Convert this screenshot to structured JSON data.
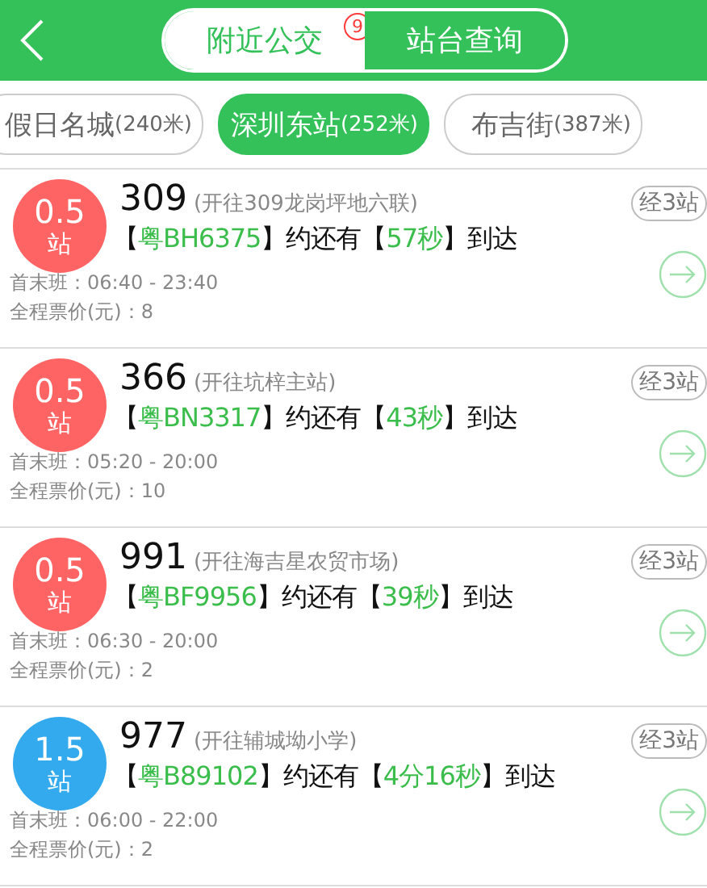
{
  "header": {
    "tabs": [
      {
        "label": "附近公交",
        "selected": true,
        "badge": "9"
      },
      {
        "label": "站台查询",
        "selected": false
      }
    ]
  },
  "stations": [
    {
      "label": "假日名城",
      "distance": "(240米)",
      "selected": false
    },
    {
      "label": "深圳东站",
      "distance": "(252米)",
      "selected": true
    },
    {
      "label": "布吉街",
      "distance": "(387米)",
      "selected": false
    }
  ],
  "buses": [
    {
      "stops": "0.5",
      "stops_unit": "站",
      "color": "#ff6464",
      "route": "309",
      "destination": "(开往309龙岗坪地六联)",
      "arrival": [
        {
          "text": "【",
          "highlight": false
        },
        {
          "text": "粤BH6375",
          "highlight": true
        },
        {
          "text": "】约还有【",
          "highlight": false
        },
        {
          "text": "57秒",
          "highlight": true
        },
        {
          "text": "】到达",
          "highlight": false
        }
      ],
      "hours": "首末班：06:40 - 23:40",
      "fare": "全程票价(元)：8",
      "via": "经3站"
    },
    {
      "stops": "0.5",
      "stops_unit": "站",
      "color": "#ff6464",
      "route": "366",
      "destination": "(开往坑梓主站)",
      "arrival": [
        {
          "text": "【",
          "highlight": false
        },
        {
          "text": "粤BN3317",
          "highlight": true
        },
        {
          "text": "】约还有【",
          "highlight": false
        },
        {
          "text": "43秒",
          "highlight": true
        },
        {
          "text": "】到达",
          "highlight": false
        }
      ],
      "hours": "首末班：05:20 - 20:00",
      "fare": "全程票价(元)：10",
      "via": "经3站"
    },
    {
      "stops": "0.5",
      "stops_unit": "站",
      "color": "#ff6464",
      "route": "991",
      "destination": "(开往海吉星农贸市场)",
      "arrival": [
        {
          "text": "【",
          "highlight": false
        },
        {
          "text": "粤BF9956",
          "highlight": true
        },
        {
          "text": "】约还有【",
          "highlight": false
        },
        {
          "text": "39秒",
          "highlight": true
        },
        {
          "text": "】到达",
          "highlight": false
        }
      ],
      "hours": "首末班：06:30 - 20:00",
      "fare": "全程票价(元)：2",
      "via": "经3站"
    },
    {
      "stops": "1.5",
      "stops_unit": "站",
      "color": "#33a9ee",
      "route": "977",
      "destination": "(开往辅城坳小学)",
      "arrival": [
        {
          "text": "【",
          "highlight": false
        },
        {
          "text": "粤B89102",
          "highlight": true
        },
        {
          "text": "】约还有【",
          "highlight": false
        },
        {
          "text": "4分16秒",
          "highlight": true
        },
        {
          "text": "】到达",
          "highlight": false
        }
      ],
      "hours": "首末班：06:00 - 22:00",
      "fare": "全程票价(元)：2",
      "via": "经3站"
    }
  ]
}
